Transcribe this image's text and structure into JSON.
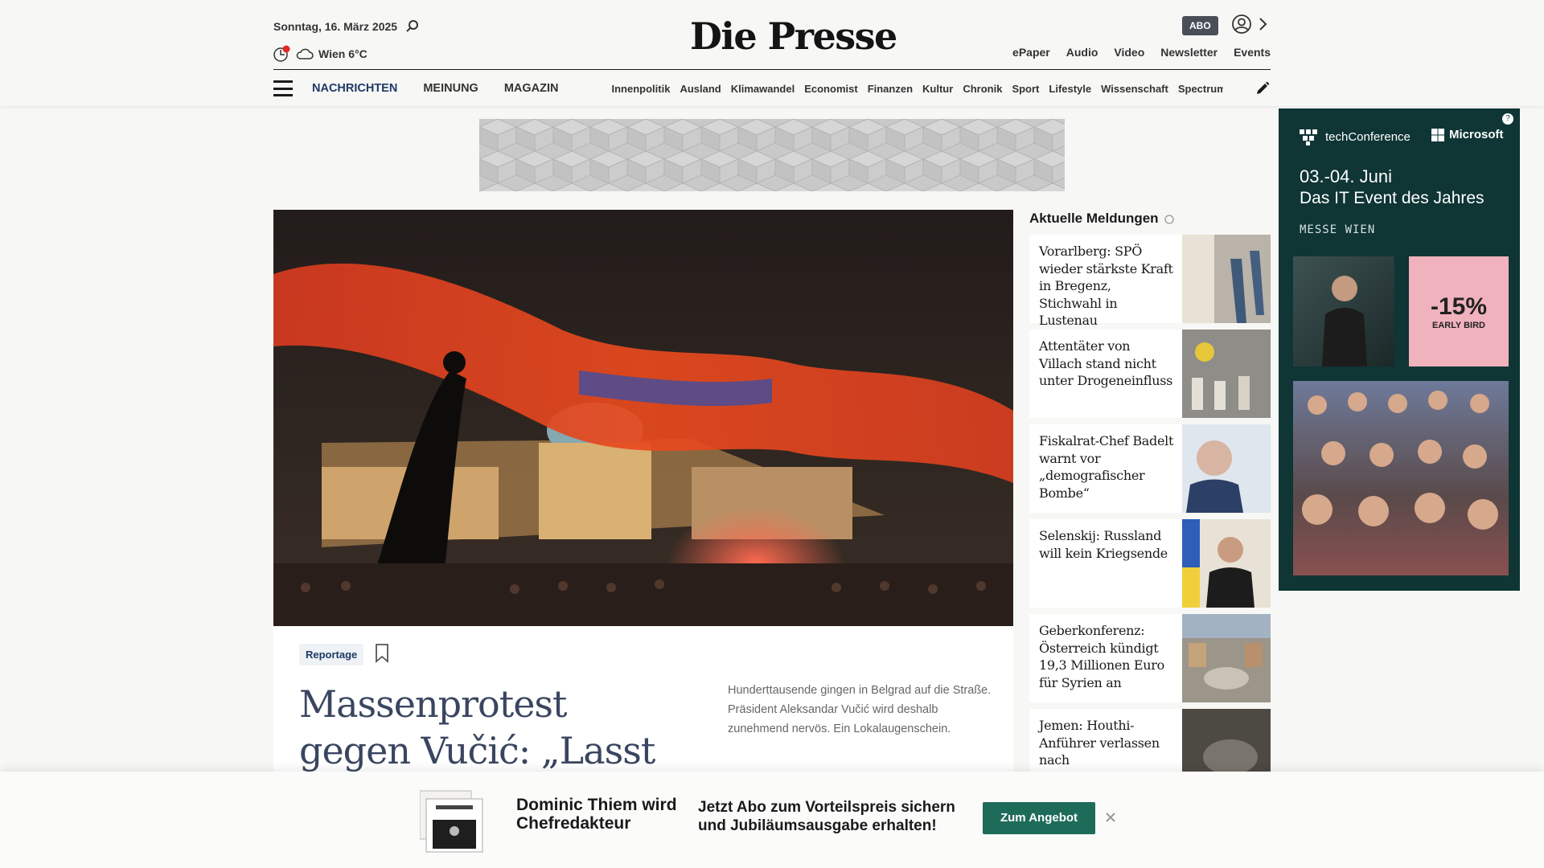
{
  "header": {
    "date": "Sonntag, 16. März 2025",
    "weather": "Wien 6°C",
    "logo": "Die Presse",
    "abo_label": "ABO",
    "top_links": [
      "ePaper",
      "Audio",
      "Video",
      "Newsletter",
      "Events"
    ]
  },
  "nav": {
    "main": [
      "NACHRICHTEN",
      "MEINUNG",
      "MAGAZIN"
    ],
    "sub": [
      "Innenpolitik",
      "Ausland",
      "Klimawandel",
      "Economist",
      "Finanzen",
      "Kultur",
      "Chronik",
      "Sport",
      "Lifestyle",
      "Wissenschaft",
      "Spectrum"
    ]
  },
  "ad_right": {
    "brand": "techConference",
    "partner": "Microsoft",
    "date": "03.-04. Juni",
    "slogan": "Das IT Event des Jahres",
    "venue": "MESSE WIEN",
    "discount": "-15%",
    "discount_label": "EARLY BIRD"
  },
  "article": {
    "tag": "Reportage",
    "headline": "Massenprotest gegen Vučić: „Lasst uns",
    "lead": "Hunderttausende gingen in Belgrad auf die Straße. Präsident Aleksandar Vučić wird deshalb zunehmend nervös. Ein Lokalaugenschein."
  },
  "news": {
    "title": "Aktuelle Meldungen",
    "items": [
      {
        "title": "Vorarlberg: SPÖ wieder stärkste Kraft in Bregenz, Stichwahl in Lustenau"
      },
      {
        "title": "Attentäter von Villach stand nicht unter Drogeneinfluss"
      },
      {
        "title": "Fiskalrat-Chef Badelt warnt vor „demografischer Bombe“"
      },
      {
        "title": "Selenskij: Russland will kein Kriegsende"
      },
      {
        "title": "Geberkonferenz: Österreich kündigt 19,3 Millionen Euro für Syrien an"
      },
      {
        "title": "Jemen: Houthi-Anführer verlassen nach"
      }
    ]
  },
  "banner": {
    "line1": "Dominic Thiem wird Chefredakteur",
    "line2": "Jetzt Abo zum Vorteilspreis sichern und Jubiläumsausgabe erhalten!",
    "cta": "Zum Angebot"
  }
}
